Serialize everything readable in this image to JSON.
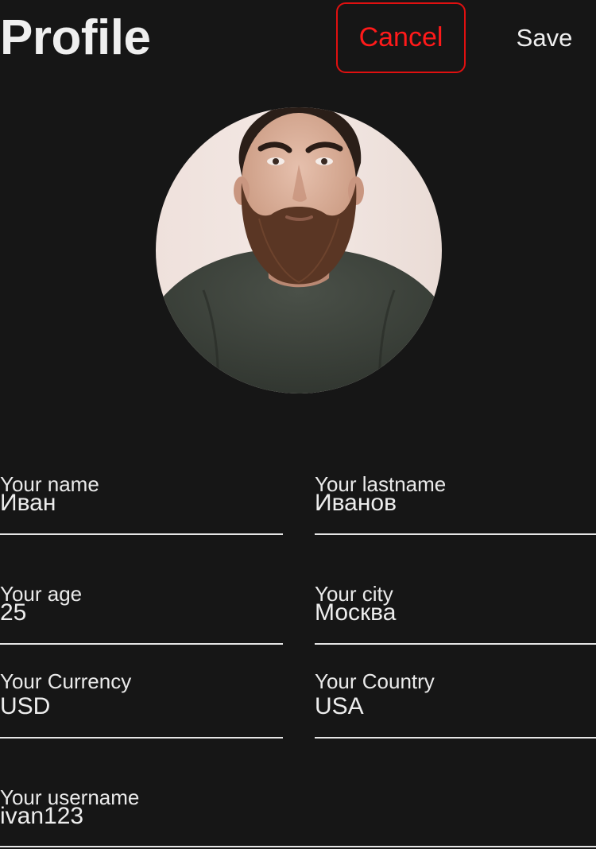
{
  "header": {
    "title": "Profile",
    "cancel_label": "Cancel",
    "save_label": "Save"
  },
  "colors": {
    "background": "#161616",
    "accent_red": "#ff1a1a",
    "text": "#ededed"
  },
  "avatar": {
    "alt": "profile photo"
  },
  "fields": {
    "name": {
      "label": "Your name",
      "value": "Иван"
    },
    "lastname": {
      "label": "Your lastname",
      "value": "Иванов"
    },
    "age": {
      "label": "Your age",
      "value": "25"
    },
    "city": {
      "label": "Your city",
      "value": "Москва"
    },
    "currency": {
      "label": "Your Currency",
      "value": "USD"
    },
    "country": {
      "label": "Your Country",
      "value": "USA"
    },
    "username": {
      "label": "Your username",
      "value": "ivan123"
    }
  }
}
